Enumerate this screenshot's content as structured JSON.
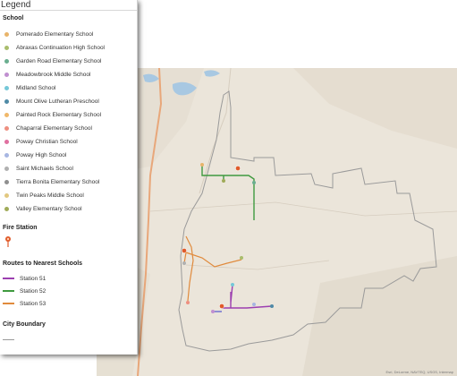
{
  "legend": {
    "title": "Legend",
    "school_section": "School",
    "schools": [
      {
        "label": "Pomerado Elementary School",
        "color": "#e8b46a"
      },
      {
        "label": "Abraxas Continuation High School",
        "color": "#a9bd6c"
      },
      {
        "label": "Garden Road Elementary School",
        "color": "#6aae8f"
      },
      {
        "label": "Meadowbrook Middle School",
        "color": "#c08fd0"
      },
      {
        "label": "Midland School",
        "color": "#75c8d8"
      },
      {
        "label": "Mount Olive Lutheran Preschool",
        "color": "#4f8aa6"
      },
      {
        "label": "Painted Rock Elementary School",
        "color": "#f0b86a"
      },
      {
        "label": "Chaparral Elementary School",
        "color": "#ee8f80"
      },
      {
        "label": "Poway Christian School",
        "color": "#e070a0"
      },
      {
        "label": "Poway High School",
        "color": "#a7b6e2"
      },
      {
        "label": "Saint Michaels School",
        "color": "#b0b0b0"
      },
      {
        "label": "Tierra Bonita Elementary School",
        "color": "#8f8f8f"
      },
      {
        "label": "Twin Peaks Middle School",
        "color": "#e2c880"
      },
      {
        "label": "Valley Elementary School",
        "color": "#a0ab58"
      }
    ],
    "fire_section": "Fire Station",
    "routes_section": "Routes to Nearest Schools",
    "routes": [
      {
        "label": "Station 51",
        "color": "#9c3fb0"
      },
      {
        "label": "Station 52",
        "color": "#3f9a3f"
      },
      {
        "label": "Station 53",
        "color": "#e08a3c"
      }
    ],
    "boundary_section": "City Boundary",
    "boundary_color": "#9a9a9a"
  },
  "map": {
    "attribution": "Esri, DeLorme, NAVTEQ, USGS, Intermap"
  }
}
